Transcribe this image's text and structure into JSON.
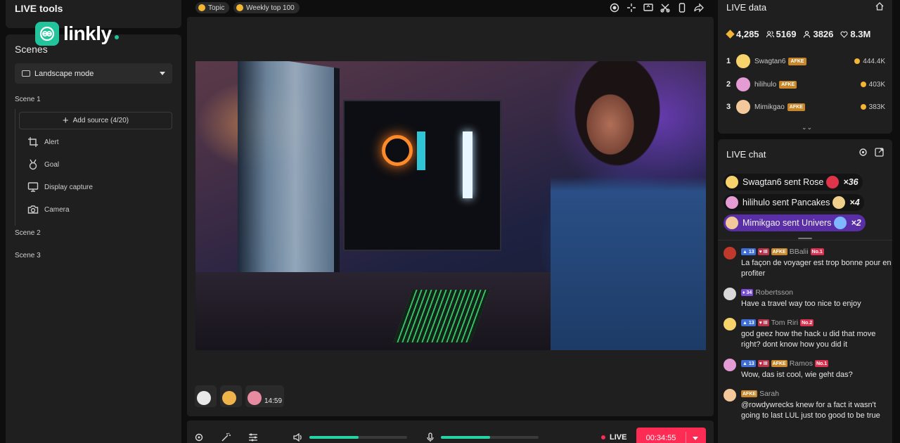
{
  "colors": {
    "accent": "#22c49c",
    "live": "#fe2c55",
    "panel": "#1f1f1f"
  },
  "logo": {
    "text": "linkly",
    "icon": "link-icon"
  },
  "left": {
    "live_tools_title": "LIVE tools",
    "scenes_title": "Scenes",
    "mode_select": "Landscape mode",
    "scene1": "Scene 1",
    "add_source": "Add source (4/20)",
    "sources": [
      {
        "label": "Alert",
        "icon": "crop-icon"
      },
      {
        "label": "Goal",
        "icon": "medal-icon"
      },
      {
        "label": "Display capture",
        "icon": "monitor-icon"
      },
      {
        "label": "Camera",
        "icon": "camera-icon"
      }
    ],
    "scene2": "Scene 2",
    "scene3": "Scene 3"
  },
  "center": {
    "chips": [
      "Topic",
      "Weekly top 100"
    ],
    "reaction_time": "14:59",
    "volume_level": 0.5,
    "mic_level": 0.5,
    "live_label": "LIVE",
    "timer": "00:34:55"
  },
  "live_data": {
    "title": "LIVE data",
    "stats": {
      "diamonds": "4,285",
      "viewers": "5169",
      "followers": "3826",
      "likes": "8.3M"
    },
    "ranks": [
      {
        "n": "1",
        "name": "Swagtan6",
        "badge": "AFKE",
        "coins": "444.4K"
      },
      {
        "n": "2",
        "name": "hilihulo",
        "badge": "AFKE",
        "coins": "403K"
      },
      {
        "n": "3",
        "name": "Mimikgao",
        "badge": "AFKE",
        "coins": "383K"
      }
    ]
  },
  "live_chat": {
    "title": "LIVE chat",
    "gifts": [
      {
        "text": "Swagtan6 sent Rose",
        "mult": "×36"
      },
      {
        "text": "hilihulo sent Pancakes",
        "mult": "×4"
      },
      {
        "text": "Mimikgao sent Univers",
        "mult": "×2"
      }
    ],
    "messages": [
      {
        "lvl": "13",
        "heart": "III",
        "badge": "AFKE",
        "rank": "No.1",
        "name": "BBalii",
        "text": "La façon de voyager est trop bonne pour en profiter"
      },
      {
        "lvl": "34",
        "name": "Robertsson",
        "text": "Have a travel way too nice to enjoy"
      },
      {
        "lvl": "13",
        "heart": "III",
        "rank": "No.2",
        "name": "Tom Riri",
        "text": "god geez how the hack u did that move right? dont know how you did it"
      },
      {
        "lvl": "13",
        "heart": "III",
        "badge": "AFKE",
        "rank": "No.1",
        "name": "Ramos",
        "text": "Wow, das ist cool, wie geht das?"
      },
      {
        "badge": "AFKE",
        "name": "Sarah",
        "text": "@rowdywrecks knew for a fact it wasn't going to last LUL just too good to be true"
      }
    ]
  }
}
